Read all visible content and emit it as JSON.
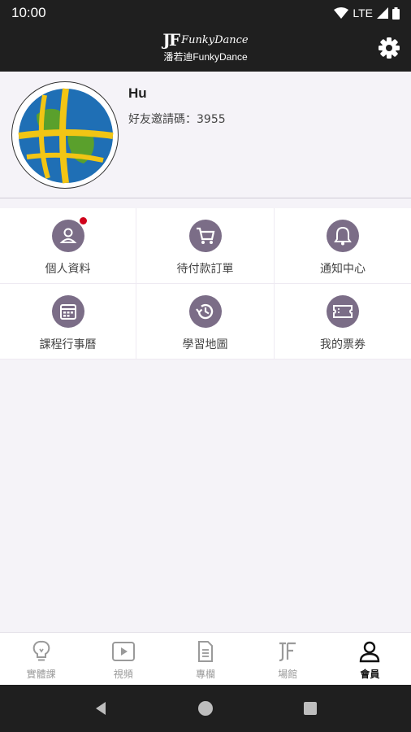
{
  "status_bar": {
    "time": "10:00",
    "network": "LTE"
  },
  "app_bar": {
    "logo_mark": "JF",
    "logo_script": "FunkyDance",
    "subtitle": "潘若迪FunkyDance",
    "settings_icon": "gear-icon"
  },
  "profile": {
    "name": "Hu",
    "invite_text": "好友邀請碼：3955",
    "avatar_icon": "globe-icon"
  },
  "menu": [
    {
      "label": "個人資料",
      "icon": "profile-icon",
      "has_badge": true
    },
    {
      "label": "待付款訂單",
      "icon": "cart-icon",
      "has_badge": false
    },
    {
      "label": "通知中心",
      "icon": "bell-icon",
      "has_badge": false
    },
    {
      "label": "課程行事曆",
      "icon": "calendar-icon",
      "has_badge": false
    },
    {
      "label": "學習地圖",
      "icon": "history-icon",
      "has_badge": false
    },
    {
      "label": "我的票券",
      "icon": "ticket-icon",
      "has_badge": false
    }
  ],
  "bottom_nav": [
    {
      "label": "實體課",
      "icon": "lightbulb-icon",
      "active": false
    },
    {
      "label": "視頻",
      "icon": "video-icon",
      "active": false
    },
    {
      "label": "專欄",
      "icon": "document-icon",
      "active": false
    },
    {
      "label": "場館",
      "icon": "venue-logo-icon",
      "active": false
    },
    {
      "label": "會員",
      "icon": "member-icon",
      "active": true
    }
  ],
  "colors": {
    "dark": "#1f1f1f",
    "accent": "#7b6d87",
    "badge": "#d0021b",
    "background": "#f5f3f8"
  }
}
